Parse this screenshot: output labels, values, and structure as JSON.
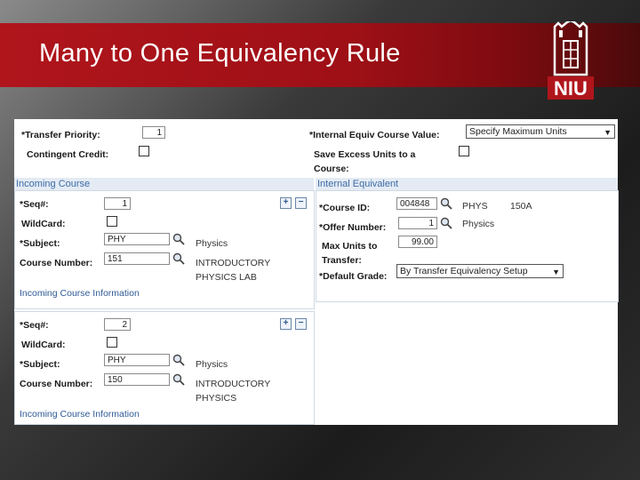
{
  "slide": {
    "title": "Many to One Equivalency Rule",
    "logo_text": "NIU"
  },
  "top": {
    "transfer_priority_label": "*Transfer Priority:",
    "transfer_priority_value": "1",
    "contingent_credit_label": "Contingent Credit:",
    "internal_equiv_label": "*Internal Equiv Course Value:",
    "internal_equiv_value": "Specify Maximum Units",
    "save_excess_label_1": "Save Excess Units to a",
    "save_excess_label_2": "Course:"
  },
  "incoming": {
    "header": "Incoming Course",
    "seq_label": "*Seq#:",
    "wildcard_label": "WildCard:",
    "subject_label": "*Subject:",
    "course_number_label": "Course Number:",
    "info_link": "Incoming Course Information",
    "rows": [
      {
        "seq": "1",
        "subject": "PHY",
        "subject_desc": "Physics",
        "course_number": "151",
        "course_desc_1": "INTRODUCTORY",
        "course_desc_2": "PHYSICS LAB"
      },
      {
        "seq": "2",
        "subject": "PHY",
        "subject_desc": "Physics",
        "course_number": "150",
        "course_desc_1": "INTRODUCTORY",
        "course_desc_2": "PHYSICS"
      }
    ]
  },
  "internal": {
    "header": "Internal Equivalent",
    "course_id_label": "*Course ID:",
    "course_id_value": "004848",
    "course_subject": "PHYS",
    "course_catalog": "150A",
    "offer_number_label": "*Offer Number:",
    "offer_number_value": "1",
    "offer_desc": "Physics",
    "max_units_label_1": "Max Units to",
    "max_units_label_2": "Transfer:",
    "max_units_value": "99.00",
    "default_grade_label": "*Default Grade:",
    "default_grade_value": "By Transfer Equivalency Setup"
  },
  "colors": {
    "banner": "#b0151c",
    "header_text": "#3d6ca6",
    "header_bg": "#e4ebf4"
  },
  "icons": [
    "magnifier-icon",
    "plus-icon",
    "minus-icon",
    "chevron-down-icon",
    "niu-logo"
  ]
}
